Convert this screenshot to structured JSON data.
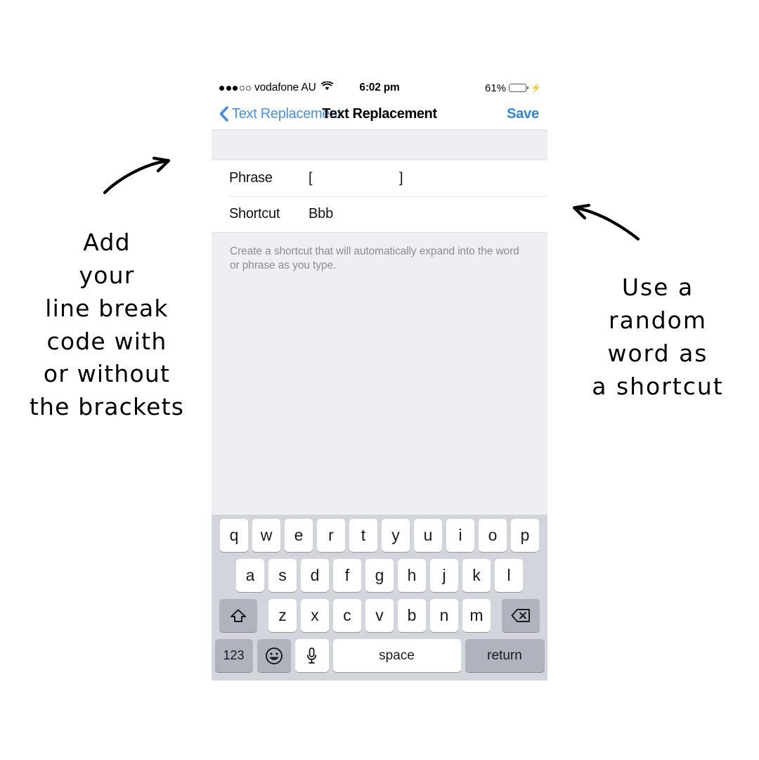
{
  "status_bar": {
    "signal_dots_filled": 3,
    "signal_dots_total": 5,
    "carrier": "vodafone AU",
    "wifi_icon": "wifi-icon",
    "time": "6:02 pm",
    "battery_percent": "61%",
    "battery_level": 61,
    "battery_color": "#4CD964",
    "charging_icon": "lightning-bolt-icon"
  },
  "nav_bar": {
    "back_icon": "chevron-left-icon",
    "back_label": "Text Replacement",
    "title": "Text Replacement",
    "save_label": "Save",
    "tint_color": "#007AFF"
  },
  "form": {
    "rows": [
      {
        "label": "Phrase",
        "value_open": "[",
        "value_close": "]"
      },
      {
        "label": "Shortcut",
        "value": "Bbb"
      }
    ],
    "footer_note": "Create a shortcut that will automatically expand into the word or phrase as you type."
  },
  "keyboard": {
    "row1": [
      "q",
      "w",
      "e",
      "r",
      "t",
      "y",
      "u",
      "i",
      "o",
      "p"
    ],
    "row2": [
      "a",
      "s",
      "d",
      "f",
      "g",
      "h",
      "j",
      "k",
      "l"
    ],
    "row3": [
      "z",
      "x",
      "c",
      "v",
      "b",
      "n",
      "m"
    ],
    "shift_icon": "shift-arrow-up-icon",
    "backspace_icon": "backspace-delete-icon",
    "numbers_label": "123",
    "emoji_icon": "smiley-face-icon",
    "dictation_icon": "microphone-icon",
    "space_label": "space",
    "return_label": "return",
    "background_color": "#D2D5DB"
  },
  "annotations": {
    "left_arrow_icon": "curved-arrow-right-icon",
    "left_note": "Add\nyour\nline break\ncode with\nor without\nthe brackets",
    "right_arrow_icon": "curved-arrow-left-icon",
    "right_note": "Use a\nrandom\nword as\na shortcut"
  }
}
